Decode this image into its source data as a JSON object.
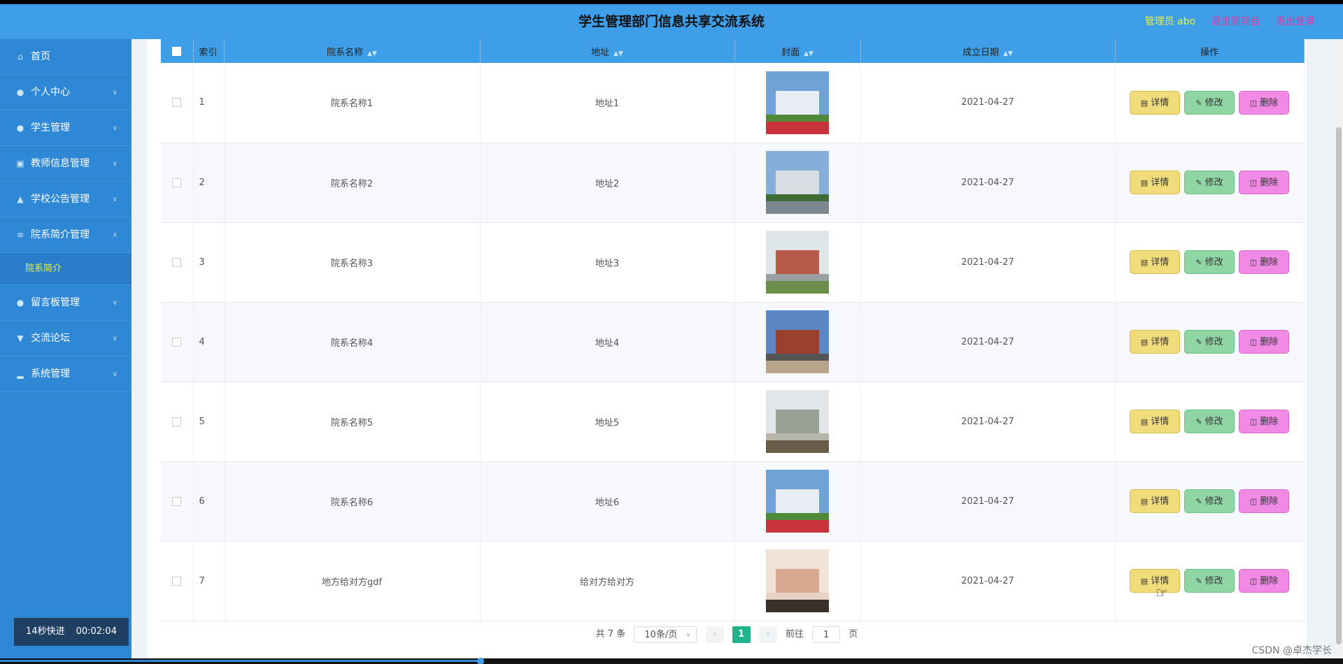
{
  "header": {
    "title": "学生管理部门信息共享交流系统",
    "admin": "管理员 abo",
    "to_front": "退出到前台",
    "logout": "退出登录"
  },
  "sidebar": {
    "items": [
      {
        "label": "首页",
        "icon": "home-icon"
      },
      {
        "label": "个人中心",
        "icon": "user-icon"
      },
      {
        "label": "学生管理",
        "icon": "user-icon"
      },
      {
        "label": "教师信息管理",
        "icon": "card-icon"
      },
      {
        "label": "学校公告管理",
        "icon": "bell-icon"
      },
      {
        "label": "院系简介管理",
        "icon": "sliders-icon"
      },
      {
        "label": "留言板管理",
        "icon": "user-icon"
      },
      {
        "label": "交流论坛",
        "icon": "cup-icon"
      },
      {
        "label": "系统管理",
        "icon": "chart-icon"
      }
    ],
    "sub_item": "院系简介",
    "timer_label": "14秒快进",
    "timer_value": "00:02:04"
  },
  "table": {
    "headers": {
      "index": "索引",
      "name": "院系名称",
      "address": "地址",
      "cover": "封面",
      "date": "成立日期",
      "action": "操作"
    },
    "buttons": {
      "detail": "详情",
      "edit": "修改",
      "delete": "删除"
    },
    "rows": [
      {
        "index": "1",
        "name": "院系名称1",
        "address": "地址1",
        "date": "2021-04-27"
      },
      {
        "index": "2",
        "name": "院系名称2",
        "address": "地址2",
        "date": "2021-04-27"
      },
      {
        "index": "3",
        "name": "院系名称3",
        "address": "地址3",
        "date": "2021-04-27"
      },
      {
        "index": "4",
        "name": "院系名称4",
        "address": "地址4",
        "date": "2021-04-27"
      },
      {
        "index": "5",
        "name": "院系名称5",
        "address": "地址5",
        "date": "2021-04-27"
      },
      {
        "index": "6",
        "name": "院系名称6",
        "address": "地址6",
        "date": "2021-04-27"
      },
      {
        "index": "7",
        "name": "地方给对方gdf",
        "address": "给对方给对方",
        "date": "2021-04-27"
      }
    ]
  },
  "pager": {
    "total": "共 7 条",
    "page_size": "10条/页",
    "current": "1",
    "goto_label": "前往",
    "goto_value": "1",
    "page_unit": "页"
  },
  "watermark": "CSDN @卓杰学长"
}
